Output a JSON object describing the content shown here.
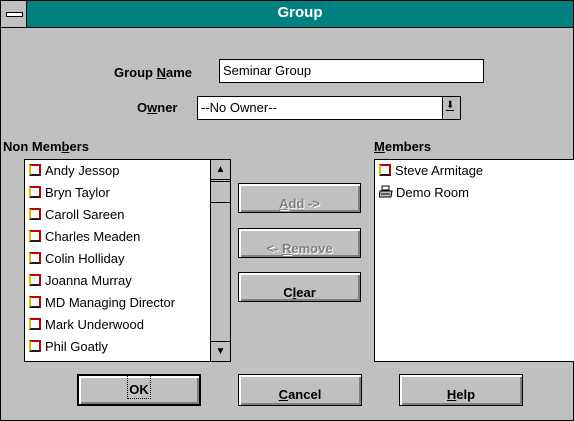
{
  "window": {
    "title": "Group"
  },
  "group_name": {
    "label": "Group Name",
    "value": "Seminar Group"
  },
  "owner": {
    "label": "Owner",
    "value": "--No Owner--"
  },
  "non_members": {
    "label": "Non Members",
    "items": [
      {
        "name": "Andy Jessop",
        "type": "person"
      },
      {
        "name": "Bryn Taylor",
        "type": "person"
      },
      {
        "name": "Caroll Sareen",
        "type": "person"
      },
      {
        "name": "Charles Meaden",
        "type": "person"
      },
      {
        "name": "Colin Holliday",
        "type": "person"
      },
      {
        "name": "Joanna Murray",
        "type": "person"
      },
      {
        "name": "MD Managing Director",
        "type": "person"
      },
      {
        "name": "Mark Underwood",
        "type": "person"
      },
      {
        "name": "Phil Goatly",
        "type": "person"
      }
    ]
  },
  "members": {
    "label": "Members",
    "items": [
      {
        "name": "Steve Armitage",
        "type": "person"
      },
      {
        "name": "Demo Room",
        "type": "resource"
      }
    ]
  },
  "buttons": {
    "add": "Add ->",
    "remove": "<- Remove",
    "clear": "Clear",
    "ok": "OK",
    "cancel": "Cancel",
    "help": "Help"
  },
  "colors": {
    "titlebar": "#008080",
    "face": "#c0c0c0"
  }
}
